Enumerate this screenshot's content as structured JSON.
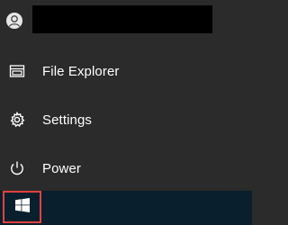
{
  "start_menu": {
    "account": {
      "avatar_icon": "user-avatar-icon",
      "name_redacted": true
    },
    "items": [
      {
        "label": "File Explorer",
        "icon": "file-explorer-icon"
      },
      {
        "label": "Settings",
        "icon": "gear-icon"
      },
      {
        "label": "Power",
        "icon": "power-icon"
      }
    ]
  },
  "taskbar": {
    "start_button": {
      "icon": "windows-logo-icon",
      "highlight_color": "#e0413e"
    }
  },
  "colors": {
    "menu_background": "#2b2b2b",
    "taskbar_background": "#0a1f2d",
    "text": "#ffffff"
  }
}
